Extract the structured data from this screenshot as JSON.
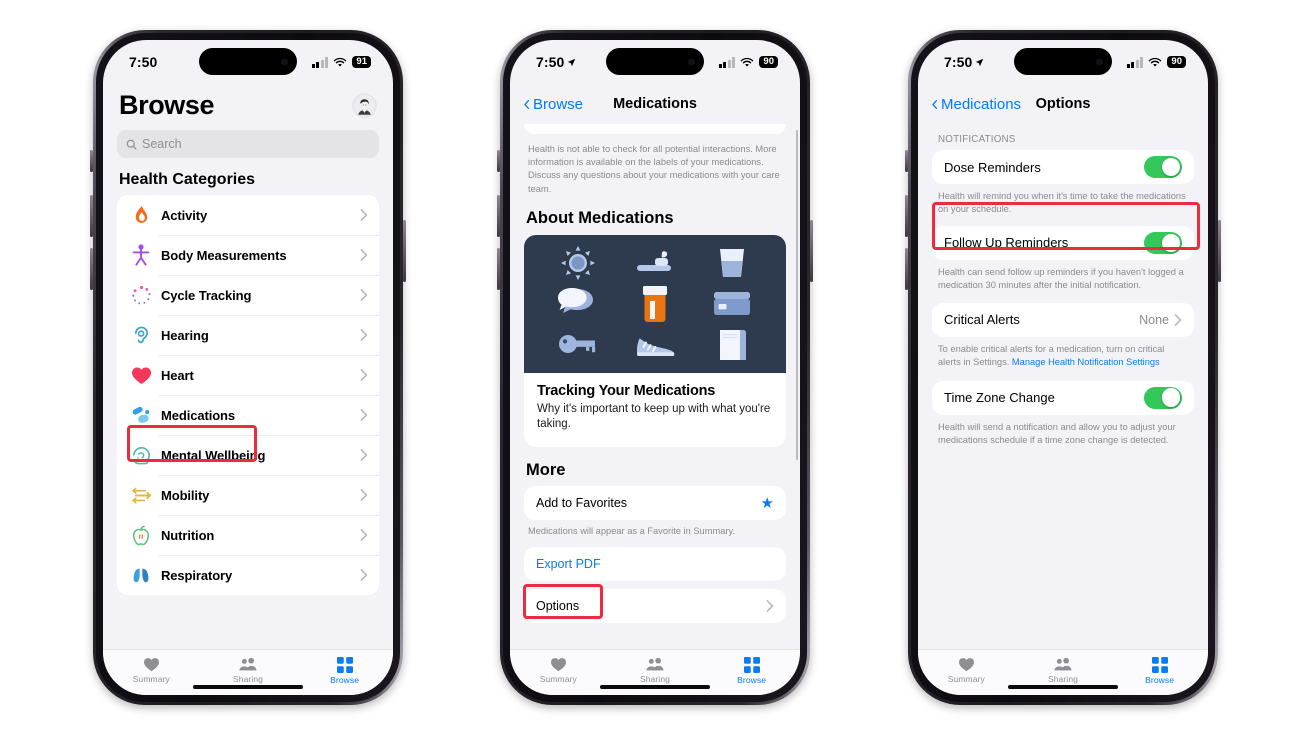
{
  "phones": [
    {
      "id": "browse",
      "status": {
        "time": "7:50",
        "battery": "91",
        "location_arrow": false
      },
      "page_title": "Browse",
      "search": {
        "placeholder": "Search",
        "icon": "search-icon"
      },
      "section_header": "Health Categories",
      "categories": [
        {
          "label": "Activity",
          "icon": "activity-flame-icon"
        },
        {
          "label": "Body Measurements",
          "icon": "body-figure-icon"
        },
        {
          "label": "Cycle Tracking",
          "icon": "cycle-tracking-icon"
        },
        {
          "label": "Hearing",
          "icon": "ear-icon"
        },
        {
          "label": "Heart",
          "icon": "heart-icon"
        },
        {
          "label": "Medications",
          "icon": "pills-icon"
        },
        {
          "label": "Mental Wellbeing",
          "icon": "brain-head-icon"
        },
        {
          "label": "Mobility",
          "icon": "mobility-arrows-icon"
        },
        {
          "label": "Nutrition",
          "icon": "apple-icon"
        },
        {
          "label": "Respiratory",
          "icon": "lungs-icon"
        }
      ],
      "tabs": [
        {
          "label": "Summary",
          "icon": "heart-icon",
          "active": false
        },
        {
          "label": "Sharing",
          "icon": "people-icon",
          "active": false
        },
        {
          "label": "Browse",
          "icon": "grid-icon",
          "active": true
        }
      ]
    },
    {
      "id": "medications",
      "status": {
        "time": "7:50",
        "battery": "90",
        "location_arrow": true
      },
      "nav": {
        "back_label": "Browse",
        "title": "Medications"
      },
      "interaction_footnote": "Health is not able to check for all potential interactions. More information is available on the labels of your medications. Discuss any questions about your medications with your care team.",
      "about_header": "About Medications",
      "article": {
        "title": "Tracking Your Medications",
        "subtitle": "Why it's important to keep up with what you're taking.",
        "image_icons": [
          "sun-icon",
          "toothbrush-icon",
          "water-glass-icon",
          "speech-bubbles-icon",
          "pill-bottle-icon",
          "card-icon",
          "key-icon",
          "sneaker-icon",
          "towel-icon"
        ]
      },
      "more_header": "More",
      "more_rows": [
        {
          "label": "Add to Favorites",
          "accessory": "star-icon",
          "note": "Medications will appear as a Favorite in Summary."
        },
        {
          "label": "Export PDF",
          "accessory": "none",
          "style": "link",
          "note": ""
        },
        {
          "label": "Options",
          "accessory": "chevron-right-icon",
          "note": ""
        }
      ],
      "tabs": [
        {
          "label": "Summary",
          "icon": "heart-icon",
          "active": false
        },
        {
          "label": "Sharing",
          "icon": "people-icon",
          "active": false
        },
        {
          "label": "Browse",
          "icon": "grid-icon",
          "active": true
        }
      ]
    },
    {
      "id": "options",
      "status": {
        "time": "7:50",
        "battery": "90",
        "location_arrow": true
      },
      "nav": {
        "back_label": "Medications",
        "title": "Options"
      },
      "group_header": "NOTIFICATIONS",
      "settings": [
        {
          "label": "Dose Reminders",
          "control": "toggle",
          "value": "on",
          "note": "Health will remind you when it's time to take the medications on your schedule."
        },
        {
          "label": "Follow Up Reminders",
          "control": "toggle",
          "value": "on",
          "note": "Health can send follow up reminders if you haven't logged a medication 30 minutes after the initial notification."
        },
        {
          "label": "Critical Alerts",
          "control": "value",
          "value": "None",
          "note": "To enable critical alerts for a medication, turn on critical alerts in Settings. ",
          "note_link": "Manage Health Notification Settings"
        },
        {
          "label": "Time Zone Change",
          "control": "toggle",
          "value": "on",
          "note": "Health will send a notification and allow you to adjust your medications schedule if a time zone change is detected."
        }
      ],
      "tabs": [
        {
          "label": "Summary",
          "icon": "heart-icon",
          "active": false
        },
        {
          "label": "Sharing",
          "icon": "people-icon",
          "active": false
        },
        {
          "label": "Browse",
          "icon": "grid-icon",
          "active": true
        }
      ]
    }
  ],
  "highlights": [
    {
      "target": "medications-category-row"
    },
    {
      "target": "options-row"
    },
    {
      "target": "follow-up-reminders-row"
    }
  ],
  "colors": {
    "accent_blue": "#0a7bf0",
    "toggle_green": "#34c759",
    "highlight_red": "#ec2b3e",
    "screen_bg": "#f2f2f7",
    "card_bg": "#ffffff",
    "article_bg": "#2e3a4e"
  }
}
